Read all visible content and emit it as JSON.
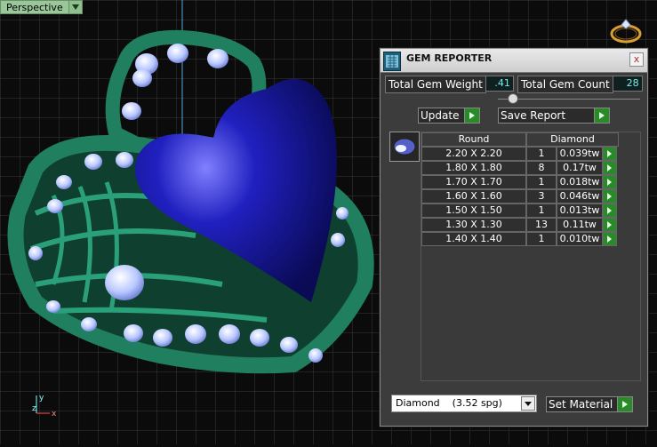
{
  "viewport": {
    "mode_label": "Perspective",
    "axis_labels": {
      "y": "y",
      "x": "x",
      "z": "z"
    }
  },
  "panel": {
    "title": "GEM REPORTER",
    "close_glyph": "x",
    "total_weight_label": "Total Gem Weight",
    "total_weight_value": ".41",
    "total_count_label": "Total Gem Count",
    "total_count_value": "28",
    "update_label": "Update",
    "save_report_label": "Save Report",
    "table": {
      "headers": [
        "Round",
        "Diamond"
      ],
      "rows": [
        {
          "size": "2.20 X 2.20",
          "count": "1",
          "weight": "0.039tw"
        },
        {
          "size": "1.80 X 1.80",
          "count": "8",
          "weight": "0.17tw"
        },
        {
          "size": "1.70 X 1.70",
          "count": "1",
          "weight": "0.018tw"
        },
        {
          "size": "1.60 X 1.60",
          "count": "3",
          "weight": "0.046tw"
        },
        {
          "size": "1.50 X 1.50",
          "count": "1",
          "weight": "0.013tw"
        },
        {
          "size": "1.30 X 1.30",
          "count": "13",
          "weight": "0.11tw"
        },
        {
          "size": "1.40 X 1.40",
          "count": "1",
          "weight": "0.010tw"
        }
      ]
    },
    "material_select": {
      "name": "Diamond",
      "spg": "(3.52 spg)"
    },
    "set_material_label": "Set Material"
  },
  "colors": {
    "accent_green": "#2a8a2a",
    "grid_line": "#3a3a3a",
    "metal_green": "#1f7f5f",
    "heart_blue": "#1b1bb0"
  },
  "icons": [
    "ring-icon",
    "gem-reporter-icon",
    "close-icon",
    "go-arrow-icon",
    "gem-thumb-icon",
    "dropdown-arrow-icon"
  ]
}
